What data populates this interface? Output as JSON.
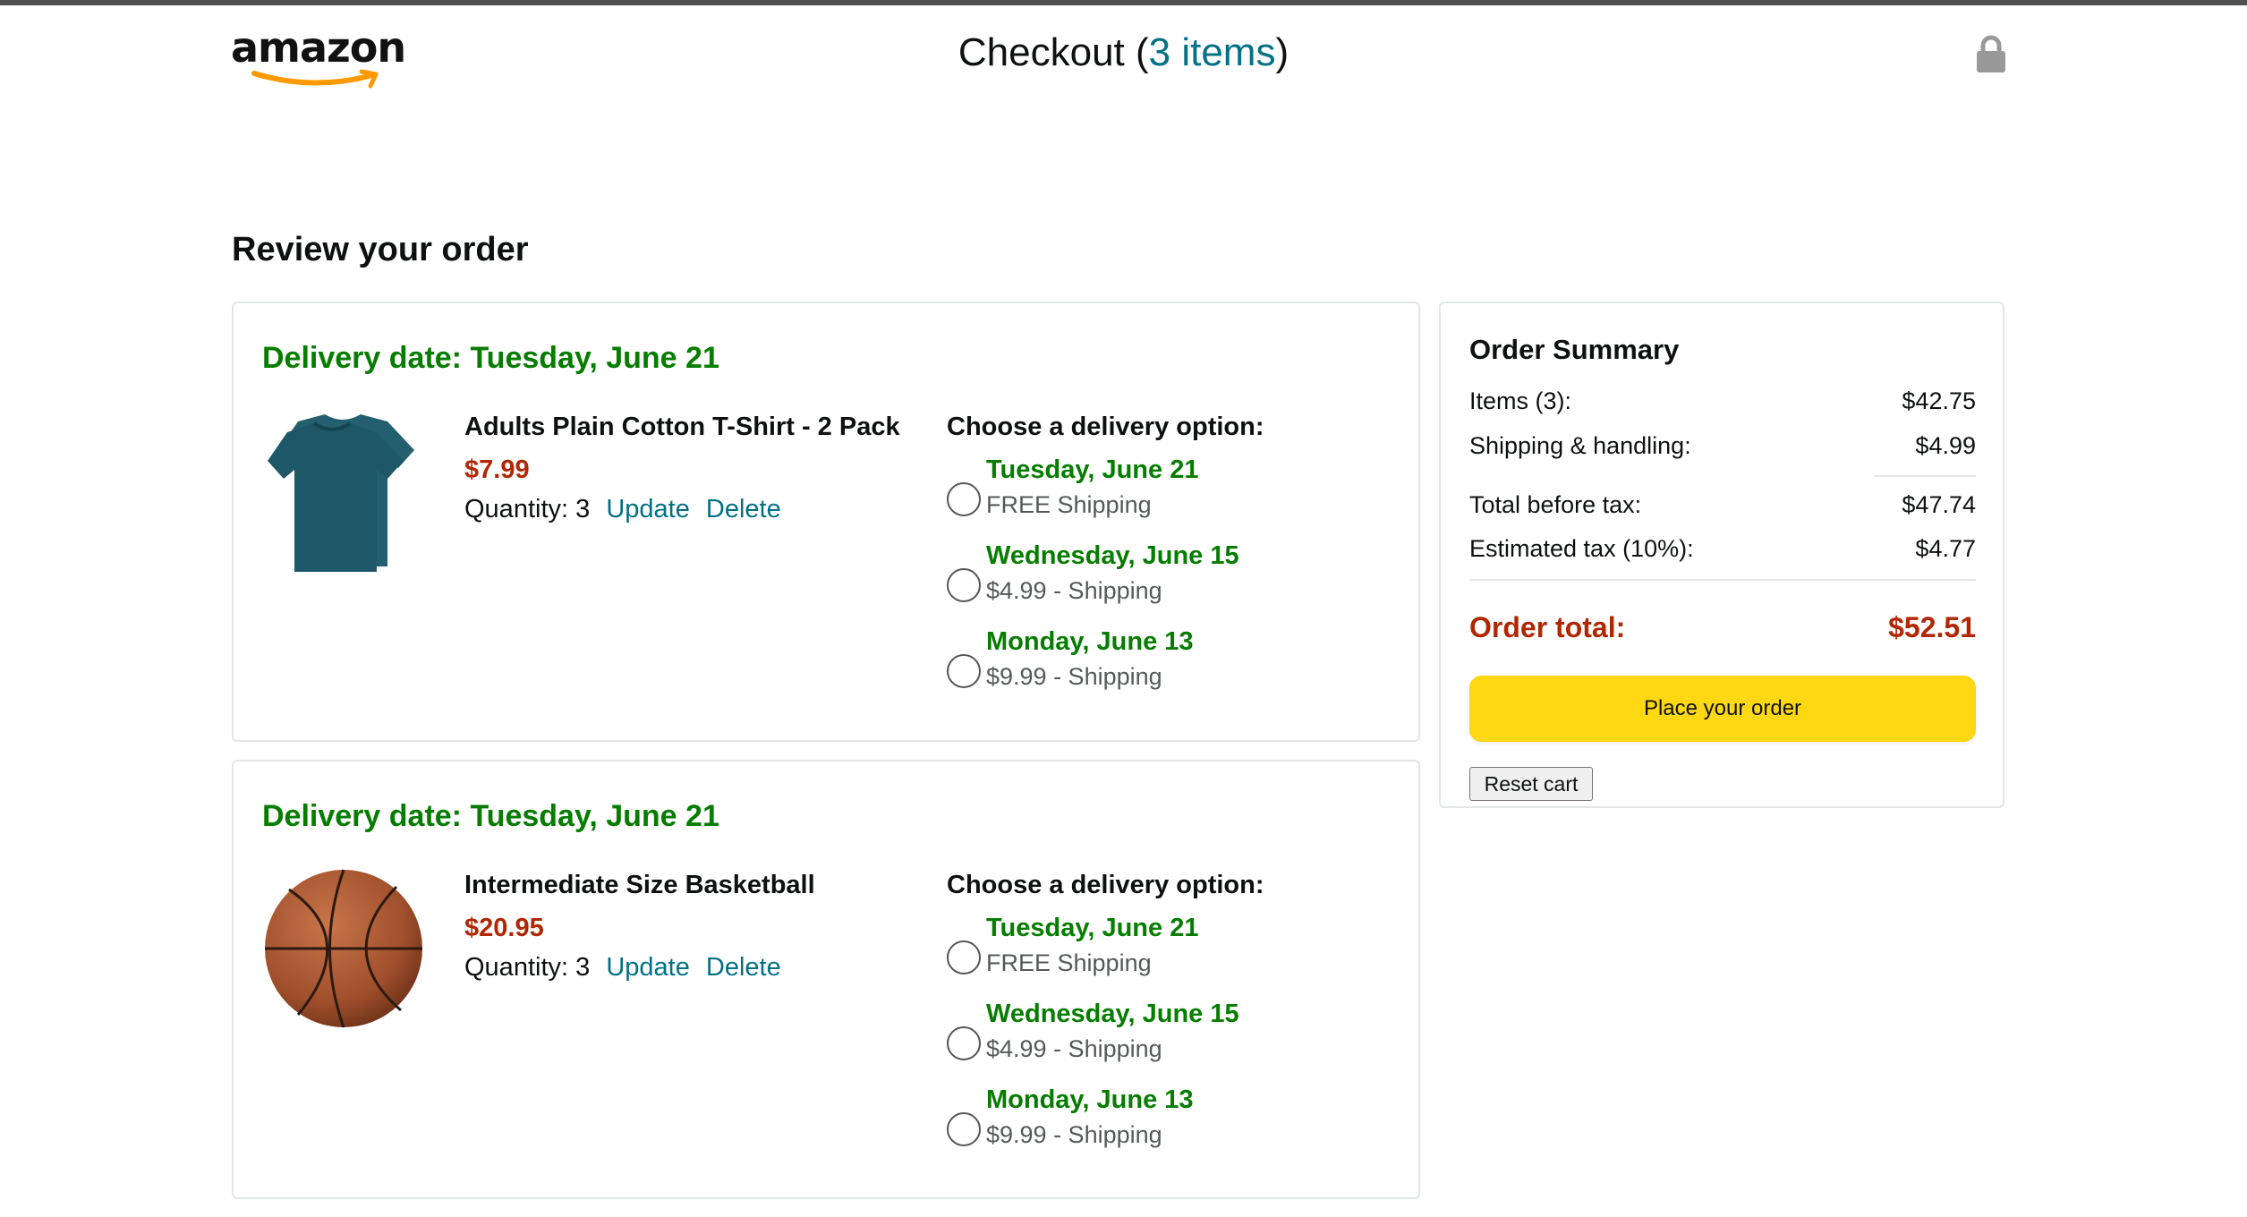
{
  "header": {
    "logo_text": "amazon",
    "checkout_label": "Checkout (",
    "items_link": "3 items",
    "checkout_close": ")"
  },
  "review_heading": "Review your order",
  "choose_label": "Choose a delivery option:",
  "orders": [
    {
      "delivery_date": "Delivery date: Tuesday, June 21",
      "product_name": "Adults Plain Cotton T-Shirt - 2 Pack",
      "price": "$7.99",
      "quantity": "Quantity: 3",
      "update_label": "Update",
      "delete_label": "Delete",
      "options": [
        {
          "date": "Tuesday, June 21",
          "price": "FREE Shipping"
        },
        {
          "date": "Wednesday, June 15",
          "price": "$4.99 - Shipping"
        },
        {
          "date": "Monday, June 13",
          "price": "$9.99 - Shipping"
        }
      ]
    },
    {
      "delivery_date": "Delivery date: Tuesday, June 21",
      "product_name": "Intermediate Size Basketball",
      "price": "$20.95",
      "quantity": "Quantity: 3",
      "update_label": "Update",
      "delete_label": "Delete",
      "options": [
        {
          "date": "Tuesday, June 21",
          "price": "FREE Shipping"
        },
        {
          "date": "Wednesday, June 15",
          "price": "$4.99 - Shipping"
        },
        {
          "date": "Monday, June 13",
          "price": "$9.99 - Shipping"
        }
      ]
    }
  ],
  "summary": {
    "title": "Order Summary",
    "items_label": "Items (3):",
    "items_value": "$42.75",
    "shipping_label": "Shipping & handling:",
    "shipping_value": "$4.99",
    "before_tax_label": "Total before tax:",
    "before_tax_value": "$47.74",
    "tax_label": "Estimated tax (10%):",
    "tax_value": "$4.77",
    "total_label": "Order total:",
    "total_value": "$52.51",
    "place_order_label": "Place your order",
    "reset_label": "Reset cart"
  },
  "colors": {
    "green": "#067d00",
    "price_red": "#b12704",
    "link_teal": "#007185",
    "button_yellow": "#ffd814"
  }
}
